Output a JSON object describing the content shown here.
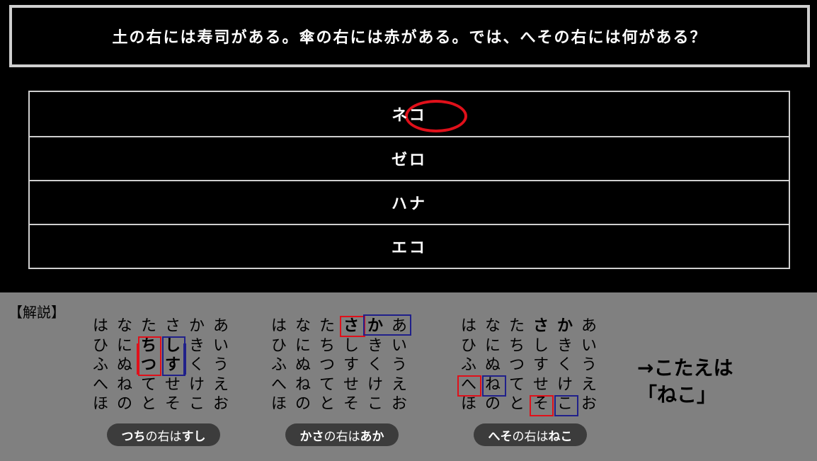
{
  "question": "土の右には寿司がある。傘の右には赤がある。では、へその右には何がある？",
  "choices": [
    "ネコ",
    "ゼロ",
    "ハナ",
    "エコ"
  ],
  "explanation": {
    "title": "【解説】",
    "rows": [
      [
        "は",
        "な",
        "た",
        "さ",
        "か",
        "あ"
      ],
      [
        "ひ",
        "に",
        "ち",
        "し",
        "き",
        "い"
      ],
      [
        "ふ",
        "ぬ",
        "つ",
        "す",
        "く",
        "う"
      ],
      [
        "へ",
        "ね",
        "て",
        "せ",
        "け",
        "え"
      ],
      [
        "ほ",
        "の",
        "と",
        "そ",
        "こ",
        "お"
      ]
    ],
    "captions": [
      {
        "a": "つち",
        "mid": "の右は",
        "b": "すし"
      },
      {
        "a": "かさ",
        "mid": "の右は",
        "b": "あか"
      },
      {
        "a": "へそ",
        "mid": "の右は",
        "b": "ねこ"
      }
    ],
    "answer_line1": "→こたえは",
    "answer_line2": "「ねこ」"
  },
  "colors": {
    "highlight_red": "#e0101a",
    "highlight_blue": "#20208a"
  }
}
